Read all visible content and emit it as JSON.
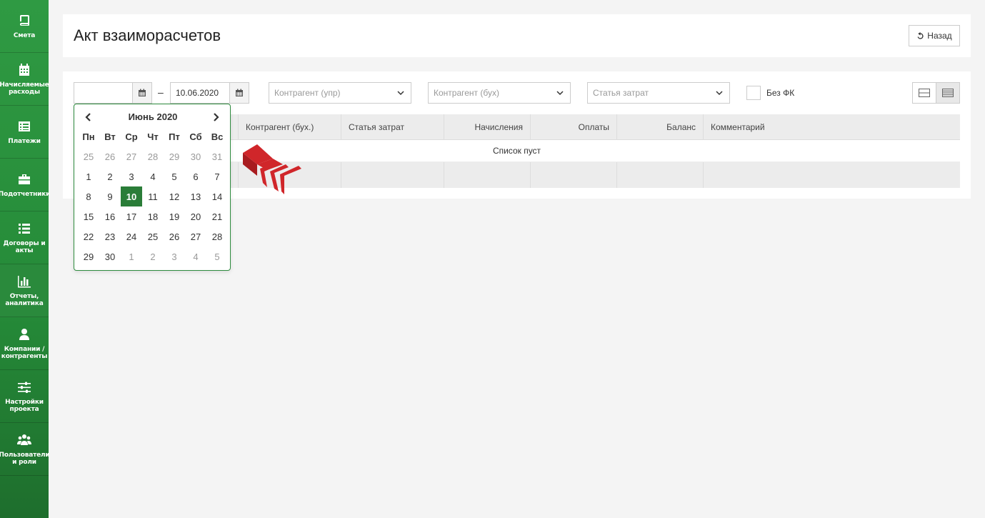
{
  "sidebar": {
    "items": [
      {
        "label": "Смета",
        "icon": "book-icon"
      },
      {
        "label": "Начисляемые расходы",
        "icon": "calendar-icon"
      },
      {
        "label": "Платежи",
        "icon": "list-alt-icon"
      },
      {
        "label": "Подотчетники",
        "icon": "briefcase-icon"
      },
      {
        "label": "Договоры и акты",
        "icon": "list-icon"
      },
      {
        "label": "Отчеты, аналитика",
        "icon": "bar-chart-icon"
      },
      {
        "label": "Компании / контрагенты",
        "icon": "user-icon"
      },
      {
        "label": "Настройки проекта",
        "icon": "sliders-icon"
      },
      {
        "label": "Пользователи и роли",
        "icon": "users-icon"
      }
    ]
  },
  "header": {
    "title": "Акт взаиморасчетов",
    "back_label": "Назад"
  },
  "filters": {
    "date_from": "",
    "dash": "–",
    "date_to": "10.06.2020",
    "counterparty_mgmt_placeholder": "Контрагент (упр)",
    "counterparty_acct_placeholder": "Контрагент (бух)",
    "cost_item_placeholder": "Статья затрат",
    "no_fk_label": "Без ФК"
  },
  "table": {
    "columns": [
      "Контрагент (бух.)",
      "Статья затрат",
      "Начисления",
      "Оплаты",
      "Баланс",
      "Комментарий"
    ],
    "empty_text": "Список пуст"
  },
  "calendar": {
    "title": "Июнь 2020",
    "weekdays": [
      "Пн",
      "Вт",
      "Ср",
      "Чт",
      "Пт",
      "Сб",
      "Вс"
    ],
    "weeks": [
      [
        "25",
        "26",
        "27",
        "28",
        "29",
        "30",
        "31"
      ],
      [
        "1",
        "2",
        "3",
        "4",
        "5",
        "6",
        "7"
      ],
      [
        "8",
        "9",
        "10",
        "11",
        "12",
        "13",
        "14"
      ],
      [
        "15",
        "16",
        "17",
        "18",
        "19",
        "20",
        "21"
      ],
      [
        "22",
        "23",
        "24",
        "25",
        "26",
        "27",
        "28"
      ],
      [
        "29",
        "30",
        "1",
        "2",
        "3",
        "4",
        "5"
      ]
    ],
    "selected": "10"
  },
  "colors": {
    "sidebar_green": "#2f9a43",
    "selected_day": "#2a7d38",
    "logo_red": "#d0262a"
  }
}
